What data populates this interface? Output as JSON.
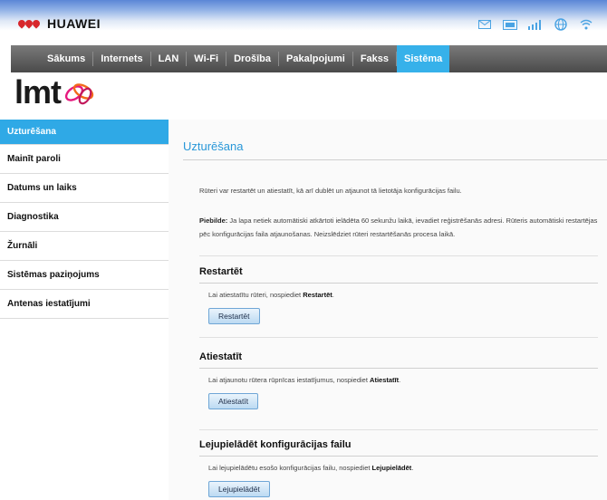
{
  "header": {
    "brand_text": "HUAWEI",
    "status_icons": [
      "mail-icon",
      "sms-icon",
      "signal-icon",
      "globe-icon",
      "wifi-icon"
    ]
  },
  "nav": {
    "items": [
      "Sākums",
      "Internets",
      "LAN",
      "Wi-Fi",
      "Drošība",
      "Pakalpojumi",
      "Fakss",
      "Sistēma"
    ],
    "active": "Sistēma"
  },
  "logo": {
    "text": "lmt"
  },
  "sidebar": {
    "items": [
      "Uzturēšana",
      "Mainīt paroli",
      "Datums un laiks",
      "Diagnostika",
      "Žurnāli",
      "Sistēmas paziņojums",
      "Antenas iestatījumi"
    ],
    "active": "Uzturēšana"
  },
  "main": {
    "title": "Uzturēšana",
    "description": "Rūteri var restartēt un atiestatīt, kā arī dublēt un atjaunot tā lietotāja konfigurācijas failu.",
    "note_label": "Piebilde:",
    "note_bold": "Ja lapa netiek automātiski atkārtoti ielādēta 60 sekunžu laikā, ievadiet reģistrēšanās adresi.",
    "note_text": "Rūteris automātiski restartējas pēc konfigurācijas faila atjaunošanas. Neizslēdziet rūteri restartēšanās procesa laikā.",
    "sections": [
      {
        "title": "Restartēt",
        "desc_prefix": "Lai atiestatītu rūteri, nospiediet ",
        "desc_bold": "Restartēt",
        "desc_suffix": ".",
        "button": "Restartēt"
      },
      {
        "title": "Atiestatīt",
        "desc_prefix": "Lai atjaunotu rūtera rūpnīcas iestatījumus, nospiediet ",
        "desc_bold": "Atiestatīt",
        "desc_suffix": ".",
        "button": "Atiestatīt"
      },
      {
        "title": "Lejupielādēt konfigurācijas failu",
        "desc_prefix": "Lai lejupielādētu esošo konfigurācijas failu, nospiediet ",
        "desc_bold": "Lejupielādēt",
        "desc_suffix": ".",
        "button": "Lejupielādēt"
      }
    ]
  },
  "colors": {
    "accent": "#2fa9e6",
    "title": "#2897d8",
    "nav_bg": "#4a4a4a",
    "brand_red": "#d7262c"
  }
}
